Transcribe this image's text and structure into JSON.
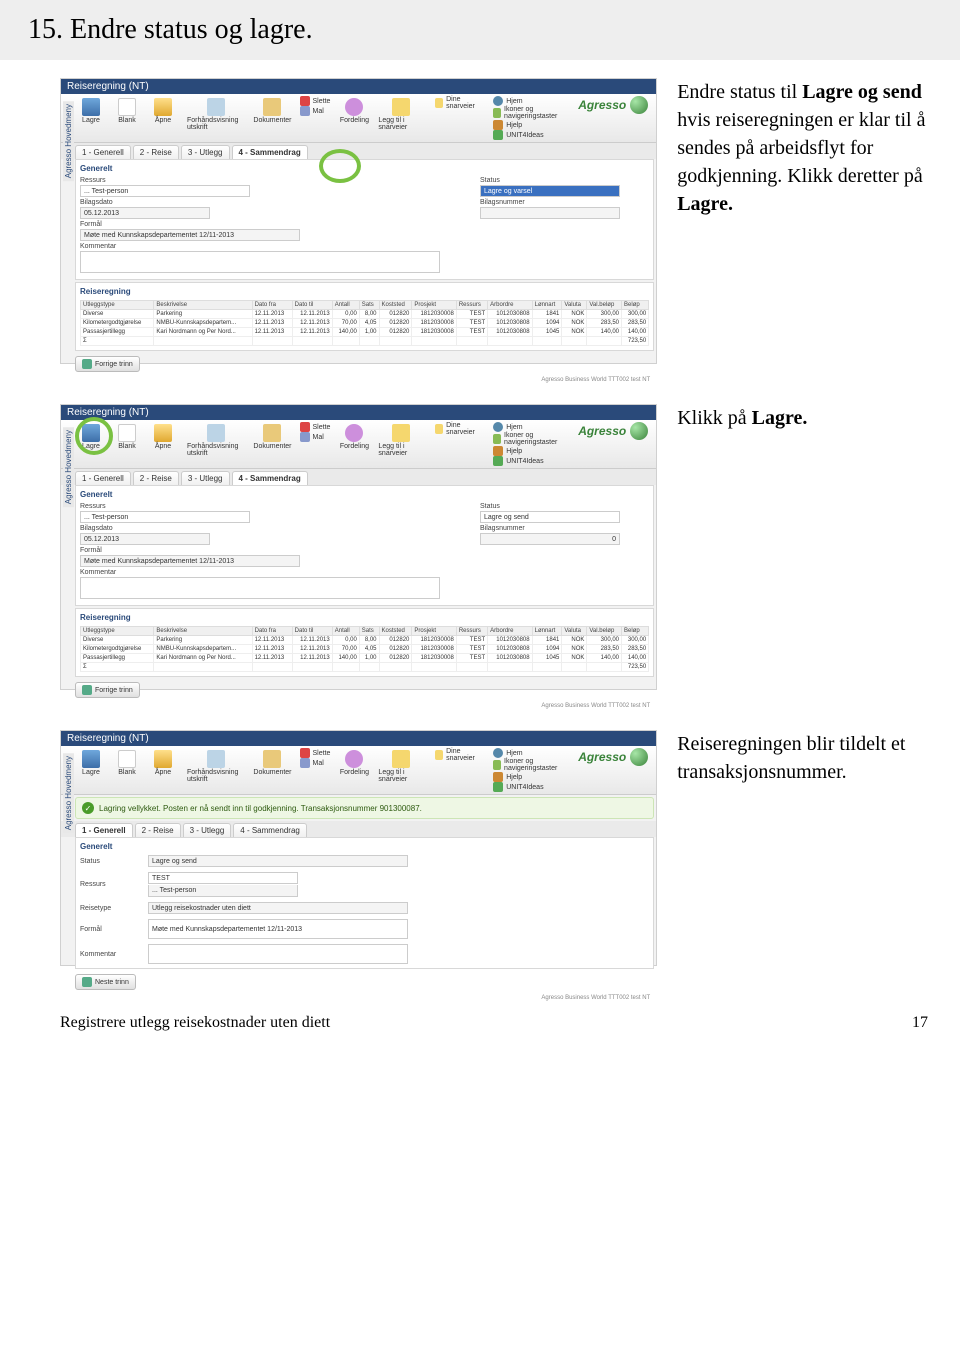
{
  "page": {
    "title": "15. Endre status og lagre.",
    "footer_left": "Registrere utlegg reisekostnader uten diett",
    "footer_right": "17"
  },
  "captions": {
    "c1_pre": "Endre status til ",
    "c1_bold1": "Lagre og send",
    "c1_mid": " hvis reiseregningen er klar til å sendes på arbeidsflyt for godkjenning. Klikk deretter på ",
    "c1_bold2": "Lagre.",
    "c2_pre": "Klikk på ",
    "c2_bold": "Lagre.",
    "c3": "Reiseregningen blir tildelt et transaksjonsnummer."
  },
  "app": {
    "window_title": "Reiseregning (NT)",
    "sidebar": "Agresso Hovedmeny",
    "brand": "Agresso",
    "footer_status": "Agresso Business World  TTT002  test  NT",
    "toolbar": {
      "lagre": "Lagre",
      "blank": "Blank",
      "apne": "Åpne",
      "forh": "Forhåndsvisning utskrift",
      "dokumenter": "Dokumenter",
      "slette": "Slette",
      "mal": "Mal",
      "fordeling": "Fordeling",
      "loggtil": "Legg til i snarveier",
      "snarveier": "Dine snarveier",
      "hjem": "Hjem",
      "ikoner": "Ikoner og navigeringstaster",
      "hjelp": "Hjelp",
      "unit4": "UNIT4Ideas"
    },
    "tabs": {
      "t1": "1 - Generell",
      "t2": "2 - Reise",
      "t3": "3 - Utlegg",
      "t4": "4 - Sammendrag"
    },
    "labels": {
      "generelt": "Generelt",
      "reiseregning": "Reiseregning",
      "ressurs": "Ressurs",
      "status": "Status",
      "bilagsdato": "Bilagsdato",
      "bilagsnummer": "Bilagsnummer",
      "formal": "Formål",
      "kommentar": "Kommentar",
      "reisetype": "Reisetype",
      "forrige": "Forrige trinn",
      "neste": "Neste trinn"
    },
    "values": {
      "ressurs": "... Test-person",
      "ressurs2": "TEST",
      "bilagsdato": "05.12.2013",
      "bilagsnummer0": "0",
      "formal": "Møte med Kunnskapsdepartementet 12/11-2013",
      "reisetype": "Utlegg reisekostnader uten diett",
      "status_lagre_send": "Lagre og send",
      "status_lagre_varsel": "Lagre og varsel"
    },
    "success": "Lagring vellykket. Posten er nå sendt inn til godkjenning. Transaksjonsnummer 901300087.",
    "table": {
      "headers": {
        "utleggstype": "Utleggstype",
        "beskrivelse": "Beskrivelse",
        "datofra": "Dato fra",
        "datotil": "Dato til",
        "antall": "Antall",
        "sats": "Sats",
        "koststed": "Koststed",
        "prosjekt": "Prosjekt",
        "ressurs": "Ressurs",
        "arbordre": "Arbordre",
        "lonnart": "Lønnart",
        "valuta": "Valuta",
        "valbelop": "Val.beløp",
        "belop": "Beløp"
      },
      "rows": [
        {
          "utype": "Diverse",
          "beskr": "Parkering",
          "dfra": "12.11.2013",
          "dtil": "12.11.2013",
          "antall": "0,00",
          "sats": "8,00",
          "kost": "012820",
          "pros": "1812030008",
          "res": "TEST",
          "arb": "1012030808",
          "lart": "1841",
          "val": "NOK",
          "vbel": "300,00",
          "bel": "300,00"
        },
        {
          "utype": "Kilometergodtgjørelse",
          "beskr": "NMBU-Kunnskapsdepartem...",
          "dfra": "12.11.2013",
          "dtil": "12.11.2013",
          "antall": "70,00",
          "sats": "4,05",
          "kost": "012820",
          "pros": "1812030008",
          "res": "TEST",
          "arb": "1012030808",
          "lart": "1094",
          "val": "NOK",
          "vbel": "283,50",
          "bel": "283,50"
        },
        {
          "utype": "Passasjertillegg",
          "beskr": "Kari Nordmann og Per Nord...",
          "dfra": "12.11.2013",
          "dtil": "12.11.2013",
          "antall": "140,00",
          "sats": "1,00",
          "kost": "012820",
          "pros": "1812030008",
          "res": "TEST",
          "arb": "1012030808",
          "lart": "1045",
          "val": "NOK",
          "vbel": "140,00",
          "bel": "140,00"
        }
      ],
      "sum_label": "Σ",
      "sum": "723,50"
    }
  }
}
